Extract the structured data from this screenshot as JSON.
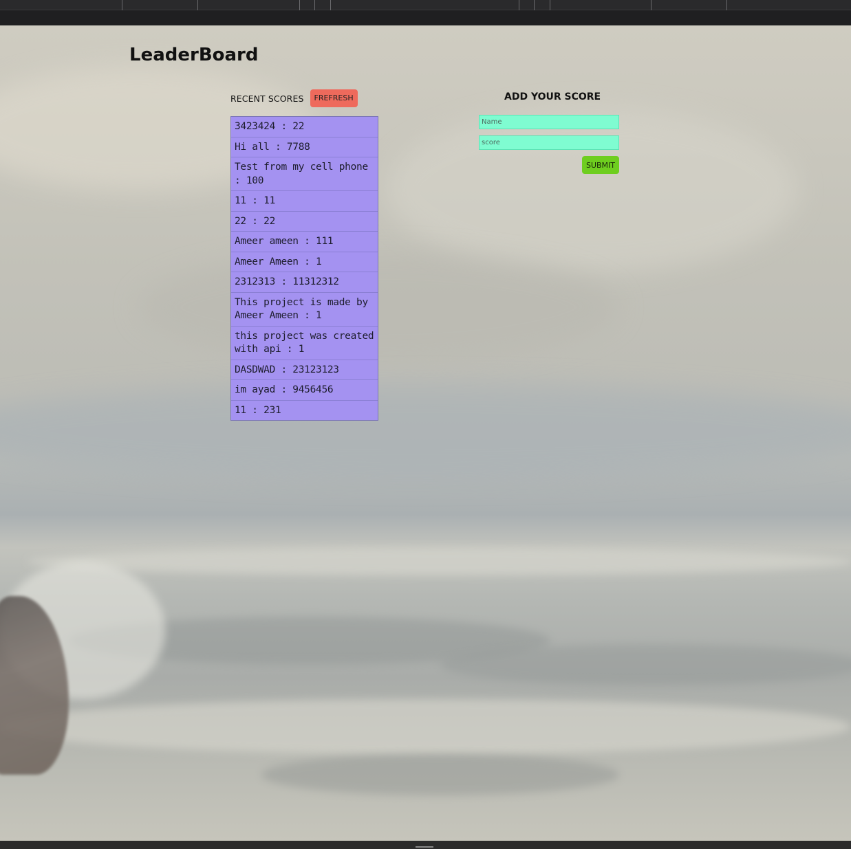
{
  "page": {
    "title": "LeaderBoard"
  },
  "recent": {
    "title": "RECENT SCORES",
    "refresh_label": "FREFRESH",
    "scores": [
      "3423424 : 22",
      "Hi all : 7788",
      "Test from my cell phone : 100",
      "11 : 11",
      "22 : 22",
      "Ameer ameen : 111",
      "Ameer Ameen : 1",
      "2312313 : 11312312",
      "This project is made by Ameer Ameen : 1",
      "this project was created with api : 1",
      "DASDWAD : 23123123",
      "im ayad : 9456456",
      "11 : 231"
    ]
  },
  "add_score": {
    "title": "ADD YOUR SCORE",
    "name_placeholder": "Name",
    "score_placeholder": "score",
    "submit_label": "SUBMIT"
  },
  "colors": {
    "score_item_bg": "#a492f1",
    "refresh_bg": "#ee6a5c",
    "input_bg": "#7ffcd1",
    "submit_bg": "#6ece1f"
  }
}
